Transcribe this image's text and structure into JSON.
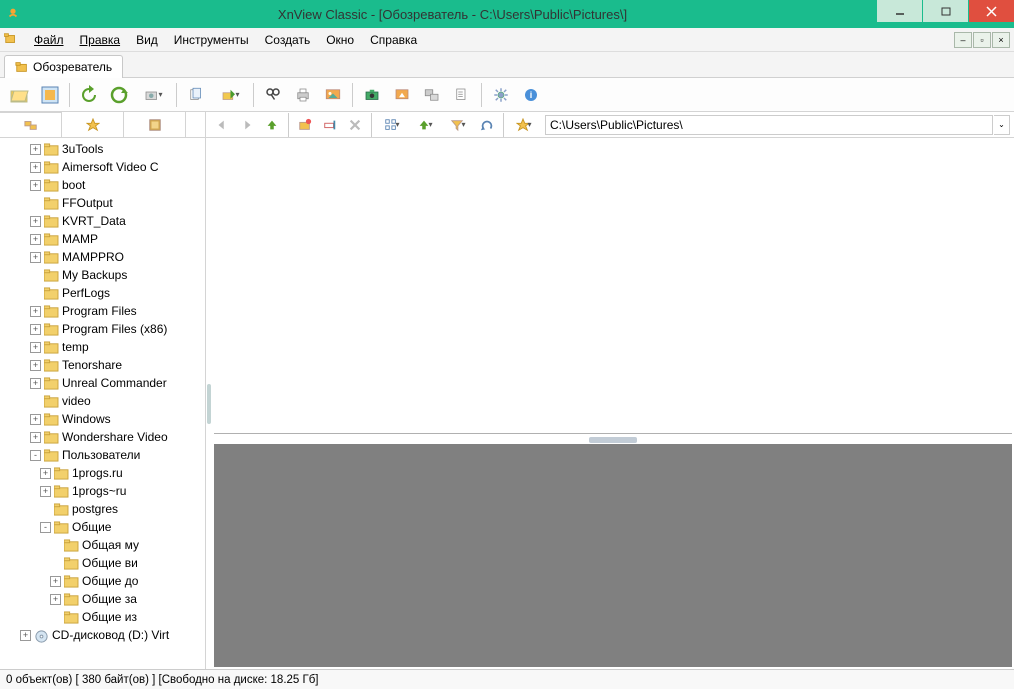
{
  "title": "XnView Classic - [Обозреватель - C:\\Users\\Public\\Pictures\\]",
  "menu": {
    "file": "Файл",
    "edit": "Правка",
    "view": "Вид",
    "tools": "Инструменты",
    "create": "Создать",
    "window": "Окно",
    "help": "Справка"
  },
  "tab": {
    "browser": "Обозреватель"
  },
  "path": {
    "value": "C:\\Users\\Public\\Pictures\\"
  },
  "tree": [
    {
      "depth": 3,
      "exp": "+",
      "label": "3uTools"
    },
    {
      "depth": 3,
      "exp": "+",
      "label": "Aimersoft Video C"
    },
    {
      "depth": 3,
      "exp": "+",
      "label": "boot"
    },
    {
      "depth": 3,
      "exp": " ",
      "label": "FFOutput"
    },
    {
      "depth": 3,
      "exp": "+",
      "label": "KVRT_Data"
    },
    {
      "depth": 3,
      "exp": "+",
      "label": "MAMP"
    },
    {
      "depth": 3,
      "exp": "+",
      "label": "MAMPPRO"
    },
    {
      "depth": 3,
      "exp": " ",
      "label": "My Backups"
    },
    {
      "depth": 3,
      "exp": " ",
      "label": "PerfLogs"
    },
    {
      "depth": 3,
      "exp": "+",
      "label": "Program Files"
    },
    {
      "depth": 3,
      "exp": "+",
      "label": "Program Files (x86)"
    },
    {
      "depth": 3,
      "exp": "+",
      "label": "temp"
    },
    {
      "depth": 3,
      "exp": "+",
      "label": "Tenorshare"
    },
    {
      "depth": 3,
      "exp": "+",
      "label": "Unreal Commander"
    },
    {
      "depth": 3,
      "exp": " ",
      "label": "video"
    },
    {
      "depth": 3,
      "exp": "+",
      "label": "Windows"
    },
    {
      "depth": 3,
      "exp": "+",
      "label": "Wondershare Video"
    },
    {
      "depth": 3,
      "exp": "-",
      "label": "Пользователи"
    },
    {
      "depth": 4,
      "exp": "+",
      "label": "1progs.ru"
    },
    {
      "depth": 4,
      "exp": "+",
      "label": "1progs~ru"
    },
    {
      "depth": 4,
      "exp": " ",
      "label": "postgres"
    },
    {
      "depth": 4,
      "exp": "-",
      "label": "Общие"
    },
    {
      "depth": 5,
      "exp": " ",
      "label": "Общая му"
    },
    {
      "depth": 5,
      "exp": " ",
      "label": "Общие ви"
    },
    {
      "depth": 5,
      "exp": "+",
      "label": "Общие до"
    },
    {
      "depth": 5,
      "exp": "+",
      "label": "Общие за"
    },
    {
      "depth": 5,
      "exp": " ",
      "label": "Общие из"
    },
    {
      "depth": 2,
      "exp": "+",
      "label": "CD-дисковод (D:) Virt",
      "icon": "cd"
    }
  ],
  "status": "0 объект(ов) [ 380 байт(ов) ] [Свободно на диске: 18.25 Гб]"
}
